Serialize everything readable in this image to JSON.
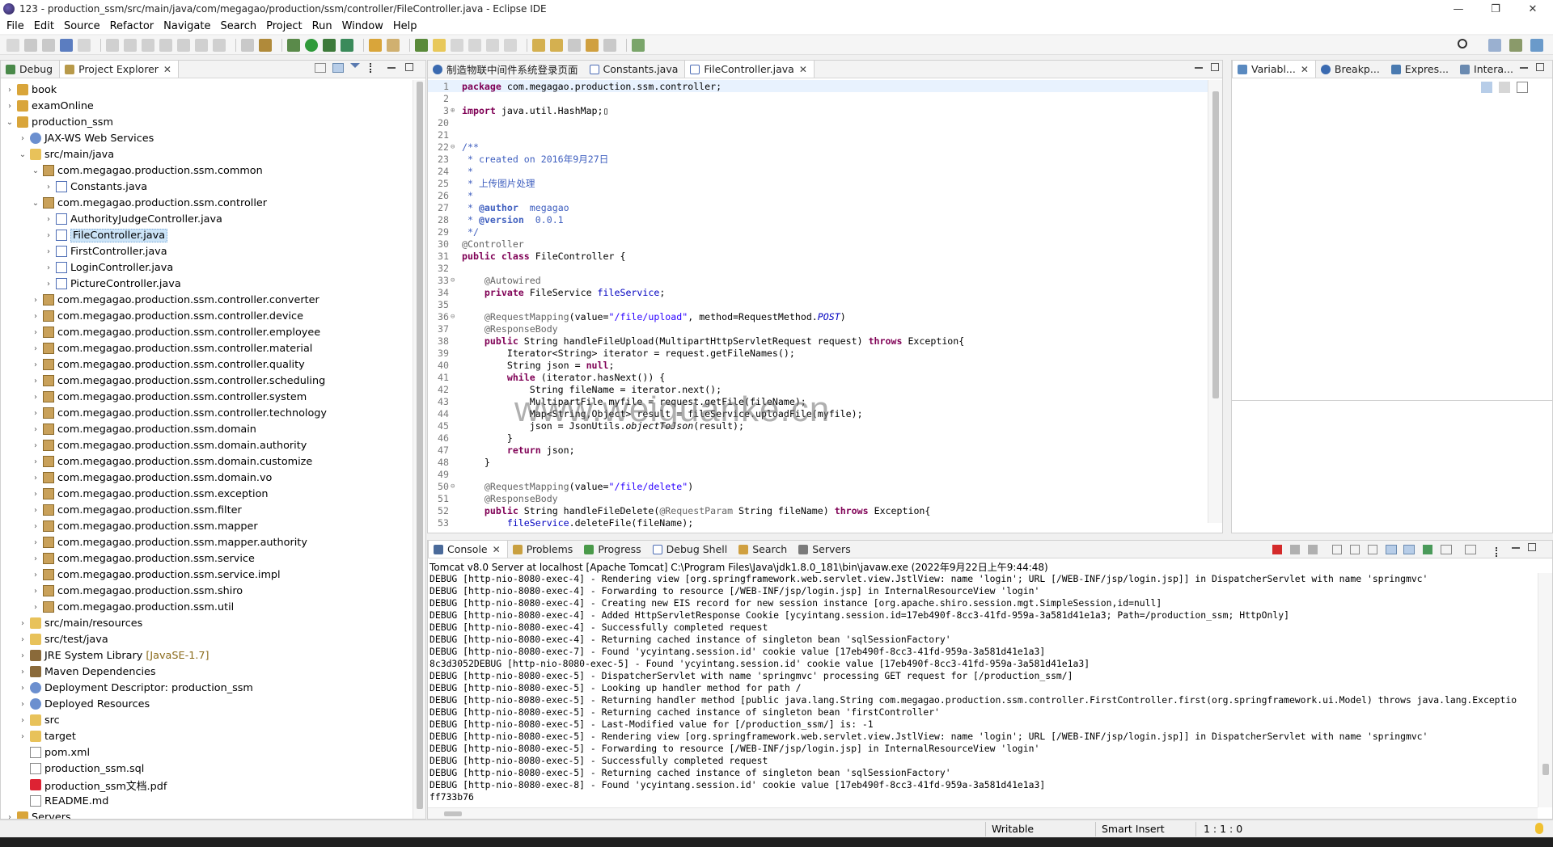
{
  "window": {
    "title": "123 - production_ssm/src/main/java/com/megagao/production/ssm/controller/FileController.java - Eclipse IDE",
    "minimize_glyph": "—",
    "maximize_glyph": "❐",
    "close_glyph": "✕"
  },
  "menu": [
    "File",
    "Edit",
    "Source",
    "Refactor",
    "Navigate",
    "Search",
    "Project",
    "Run",
    "Window",
    "Help"
  ],
  "left_panel": {
    "tabs": [
      {
        "label": "Debug",
        "icon": "debug-icon"
      },
      {
        "label": "Project Explorer",
        "icon": "project-explorer-icon",
        "close": "✕"
      }
    ],
    "tree": [
      {
        "indent": 0,
        "twisty": "›",
        "icon": "project",
        "label": "book"
      },
      {
        "indent": 0,
        "twisty": "›",
        "icon": "project",
        "label": "examOnline"
      },
      {
        "indent": 0,
        "twisty": "⌄",
        "icon": "project",
        "label": "production_ssm"
      },
      {
        "indent": 1,
        "twisty": "›",
        "icon": "ws",
        "label": "JAX-WS Web Services"
      },
      {
        "indent": 1,
        "twisty": "⌄",
        "icon": "folder",
        "label": "src/main/java"
      },
      {
        "indent": 2,
        "twisty": "⌄",
        "icon": "pkg",
        "label": "com.megagao.production.ssm.common"
      },
      {
        "indent": 3,
        "twisty": "›",
        "icon": "java",
        "label": "Constants.java"
      },
      {
        "indent": 2,
        "twisty": "⌄",
        "icon": "pkg",
        "label": "com.megagao.production.ssm.controller"
      },
      {
        "indent": 3,
        "twisty": "›",
        "icon": "java",
        "label": "AuthorityJudgeController.java"
      },
      {
        "indent": 3,
        "twisty": "›",
        "icon": "java",
        "label": "FileController.java",
        "selected": true
      },
      {
        "indent": 3,
        "twisty": "›",
        "icon": "java",
        "label": "FirstController.java"
      },
      {
        "indent": 3,
        "twisty": "›",
        "icon": "java",
        "label": "LoginController.java"
      },
      {
        "indent": 3,
        "twisty": "›",
        "icon": "java",
        "label": "PictureController.java"
      },
      {
        "indent": 2,
        "twisty": "›",
        "icon": "pkg",
        "label": "com.megagao.production.ssm.controller.converter"
      },
      {
        "indent": 2,
        "twisty": "›",
        "icon": "pkg",
        "label": "com.megagao.production.ssm.controller.device"
      },
      {
        "indent": 2,
        "twisty": "›",
        "icon": "pkg",
        "label": "com.megagao.production.ssm.controller.employee"
      },
      {
        "indent": 2,
        "twisty": "›",
        "icon": "pkg",
        "label": "com.megagao.production.ssm.controller.material"
      },
      {
        "indent": 2,
        "twisty": "›",
        "icon": "pkg",
        "label": "com.megagao.production.ssm.controller.quality"
      },
      {
        "indent": 2,
        "twisty": "›",
        "icon": "pkg",
        "label": "com.megagao.production.ssm.controller.scheduling"
      },
      {
        "indent": 2,
        "twisty": "›",
        "icon": "pkg",
        "label": "com.megagao.production.ssm.controller.system"
      },
      {
        "indent": 2,
        "twisty": "›",
        "icon": "pkg",
        "label": "com.megagao.production.ssm.controller.technology"
      },
      {
        "indent": 2,
        "twisty": "›",
        "icon": "pkg",
        "label": "com.megagao.production.ssm.domain"
      },
      {
        "indent": 2,
        "twisty": "›",
        "icon": "pkg",
        "label": "com.megagao.production.ssm.domain.authority"
      },
      {
        "indent": 2,
        "twisty": "›",
        "icon": "pkg",
        "label": "com.megagao.production.ssm.domain.customize"
      },
      {
        "indent": 2,
        "twisty": "›",
        "icon": "pkg",
        "label": "com.megagao.production.ssm.domain.vo"
      },
      {
        "indent": 2,
        "twisty": "›",
        "icon": "pkg",
        "label": "com.megagao.production.ssm.exception"
      },
      {
        "indent": 2,
        "twisty": "›",
        "icon": "pkg",
        "label": "com.megagao.production.ssm.filter"
      },
      {
        "indent": 2,
        "twisty": "›",
        "icon": "pkg",
        "label": "com.megagao.production.ssm.mapper"
      },
      {
        "indent": 2,
        "twisty": "›",
        "icon": "pkg",
        "label": "com.megagao.production.ssm.mapper.authority"
      },
      {
        "indent": 2,
        "twisty": "›",
        "icon": "pkg",
        "label": "com.megagao.production.ssm.service"
      },
      {
        "indent": 2,
        "twisty": "›",
        "icon": "pkg",
        "label": "com.megagao.production.ssm.service.impl"
      },
      {
        "indent": 2,
        "twisty": "›",
        "icon": "pkg",
        "label": "com.megagao.production.ssm.shiro"
      },
      {
        "indent": 2,
        "twisty": "›",
        "icon": "pkg",
        "label": "com.megagao.production.ssm.util"
      },
      {
        "indent": 1,
        "twisty": "›",
        "icon": "folder",
        "label": "src/main/resources"
      },
      {
        "indent": 1,
        "twisty": "›",
        "icon": "folder",
        "label": "src/test/java"
      },
      {
        "indent": 1,
        "twisty": "›",
        "icon": "lib",
        "label": "JRE System Library",
        "suffix": "[JavaSE-1.7]"
      },
      {
        "indent": 1,
        "twisty": "›",
        "icon": "lib",
        "label": "Maven Dependencies"
      },
      {
        "indent": 1,
        "twisty": "›",
        "icon": "ws",
        "label": "Deployment Descriptor: production_ssm"
      },
      {
        "indent": 1,
        "twisty": "›",
        "icon": "ws",
        "label": "Deployed Resources"
      },
      {
        "indent": 1,
        "twisty": "›",
        "icon": "folder",
        "label": "src"
      },
      {
        "indent": 1,
        "twisty": "›",
        "icon": "folder",
        "label": "target"
      },
      {
        "indent": 1,
        "twisty": "",
        "icon": "file",
        "label": "pom.xml"
      },
      {
        "indent": 1,
        "twisty": "",
        "icon": "file",
        "label": "production_ssm.sql"
      },
      {
        "indent": 1,
        "twisty": "",
        "icon": "pdf",
        "label": "production_ssm文档.pdf"
      },
      {
        "indent": 1,
        "twisty": "",
        "icon": "file",
        "label": "README.md"
      },
      {
        "indent": 0,
        "twisty": "›",
        "icon": "project",
        "label": "Servers"
      }
    ]
  },
  "editor": {
    "tabs": [
      {
        "label": "制造物联中间件系统登录页面",
        "active": false
      },
      {
        "label": "Constants.java",
        "active": false
      },
      {
        "label": "FileController.java",
        "active": true,
        "close": "✕"
      }
    ],
    "lines": [
      {
        "n": "1",
        "fold": "",
        "html": "<span class='kw'>package</span> com.megagao.production.ssm.controller;",
        "current": true
      },
      {
        "n": "2",
        "fold": "",
        "html": ""
      },
      {
        "n": "3",
        "fold": "⊕",
        "html": "<span class='kw'>import</span> java.util.HashMap;▯"
      },
      {
        "n": "20",
        "fold": "",
        "html": ""
      },
      {
        "n": "21",
        "fold": "",
        "html": ""
      },
      {
        "n": "22",
        "fold": "⊖",
        "html": "<span class='cm'>/**</span>"
      },
      {
        "n": "23",
        "fold": "",
        "html": "<span class='cm'> * created on 2016年9月27日</span>"
      },
      {
        "n": "24",
        "fold": "",
        "html": "<span class='cm'> *</span>"
      },
      {
        "n": "25",
        "fold": "",
        "html": "<span class='cm'> * 上传图片处理</span>"
      },
      {
        "n": "26",
        "fold": "",
        "html": "<span class='cm'> *</span>"
      },
      {
        "n": "27",
        "fold": "",
        "html": "<span class='cm'> * <b>@author</b>  megagao</span>"
      },
      {
        "n": "28",
        "fold": "",
        "html": "<span class='cm'> * <b>@version</b>  0.0.1</span>"
      },
      {
        "n": "29",
        "fold": "",
        "html": "<span class='cm'> */</span>"
      },
      {
        "n": "30",
        "fold": "",
        "html": "<span class='an'>@Controller</span>"
      },
      {
        "n": "31",
        "fold": "",
        "html": "<span class='kw'>public</span> <span class='kw'>class</span> FileController {"
      },
      {
        "n": "32",
        "fold": "",
        "html": ""
      },
      {
        "n": "33",
        "fold": "⊖",
        "html": "    <span class='an'>@Autowired</span>"
      },
      {
        "n": "34",
        "fold": "",
        "html": "    <span class='kw'>private</span> FileService <span class='fd'>fileService</span>;"
      },
      {
        "n": "35",
        "fold": "",
        "html": ""
      },
      {
        "n": "36",
        "fold": "⊖",
        "html": "    <span class='an'>@RequestMapping</span>(value=<span class='st'>\"/file/upload\"</span>, method=RequestMethod.<span class='fd it'>POST</span>)"
      },
      {
        "n": "37",
        "fold": "",
        "html": "    <span class='an'>@ResponseBody</span>"
      },
      {
        "n": "38",
        "fold": "",
        "html": "    <span class='kw'>public</span> String handleFileUpload(MultipartHttpServletRequest request) <span class='kw'>throws</span> Exception{"
      },
      {
        "n": "39",
        "fold": "",
        "html": "        Iterator&lt;String&gt; iterator = request.getFileNames();"
      },
      {
        "n": "40",
        "fold": "",
        "html": "        String json = <span class='kw'>null</span>;"
      },
      {
        "n": "41",
        "fold": "",
        "html": "        <span class='kw'>while</span> (iterator.hasNext()) {"
      },
      {
        "n": "42",
        "fold": "",
        "html": "            String fileName = iterator.next();"
      },
      {
        "n": "43",
        "fold": "",
        "html": "            MultipartFile myfile = request.getFile(fileName);"
      },
      {
        "n": "44",
        "fold": "",
        "html": "            Map&lt;String,Object&gt; result = fileService.uploadFile(myfile);"
      },
      {
        "n": "45",
        "fold": "",
        "html": "            json = JsonUtils.<span class='it'>objectToJson</span>(result);"
      },
      {
        "n": "46",
        "fold": "",
        "html": "        }"
      },
      {
        "n": "47",
        "fold": "",
        "html": "        <span class='kw'>return</span> json;"
      },
      {
        "n": "48",
        "fold": "",
        "html": "    }"
      },
      {
        "n": "49",
        "fold": "",
        "html": ""
      },
      {
        "n": "50",
        "fold": "⊖",
        "html": "    <span class='an'>@RequestMapping</span>(value=<span class='st'>\"/file/delete\"</span>)"
      },
      {
        "n": "51",
        "fold": "",
        "html": "    <span class='an'>@ResponseBody</span>"
      },
      {
        "n": "52",
        "fold": "",
        "html": "    <span class='kw'>public</span> String handleFileDelete(<span class='an'>@RequestParam</span> String fileName) <span class='kw'>throws</span> Exception{"
      },
      {
        "n": "53",
        "fold": "",
        "html": "        <span class='fd'>fileService</span>.deleteFile(fileName);"
      }
    ]
  },
  "right_panel": {
    "tabs": [
      {
        "label": "Variabl...",
        "close": "✕"
      },
      {
        "label": "Breakp..."
      },
      {
        "label": "Expres..."
      },
      {
        "label": "Intera..."
      }
    ]
  },
  "console": {
    "tabs": [
      {
        "label": "Console",
        "active": true,
        "close": "✕"
      },
      {
        "label": "Problems"
      },
      {
        "label": "Progress"
      },
      {
        "label": "Debug Shell"
      },
      {
        "label": "Search"
      },
      {
        "label": "Servers"
      }
    ],
    "header": "Tomcat v8.0 Server at localhost [Apache Tomcat] C:\\Program Files\\Java\\jdk1.8.0_181\\bin\\javaw.exe  (2022年9月22日上午9:44:48)",
    "lines": [
      "DEBUG [http-nio-8080-exec-4] - Rendering view [org.springframework.web.servlet.view.JstlView: name 'login'; URL [/WEB-INF/jsp/login.jsp]] in DispatcherServlet with name 'springmvc'",
      "DEBUG [http-nio-8080-exec-4] - Forwarding to resource [/WEB-INF/jsp/login.jsp] in InternalResourceView 'login'",
      "DEBUG [http-nio-8080-exec-4] - Creating new EIS record for new session instance [org.apache.shiro.session.mgt.SimpleSession,id=null]",
      "DEBUG [http-nio-8080-exec-4] - Added HttpServletResponse Cookie [ycyintang.session.id=17eb490f-8cc3-41fd-959a-3a581d41e1a3; Path=/production_ssm; HttpOnly]",
      "DEBUG [http-nio-8080-exec-4] - Successfully completed request",
      "DEBUG [http-nio-8080-exec-4] - Returning cached instance of singleton bean 'sqlSessionFactory'",
      "DEBUG [http-nio-8080-exec-7] - Found 'ycyintang.session.id' cookie value [17eb490f-8cc3-41fd-959a-3a581d41e1a3]",
      "8c3d3052DEBUG [http-nio-8080-exec-5] - Found 'ycyintang.session.id' cookie value [17eb490f-8cc3-41fd-959a-3a581d41e1a3]",
      "DEBUG [http-nio-8080-exec-5] - DispatcherServlet with name 'springmvc' processing GET request for [/production_ssm/]",
      "DEBUG [http-nio-8080-exec-5] - Looking up handler method for path /",
      "DEBUG [http-nio-8080-exec-5] - Returning handler method [public java.lang.String com.megagao.production.ssm.controller.FirstController.first(org.springframework.ui.Model) throws java.lang.Exceptio",
      "DEBUG [http-nio-8080-exec-5] - Returning cached instance of singleton bean 'firstController'",
      "DEBUG [http-nio-8080-exec-5] - Last-Modified value for [/production_ssm/] is: -1",
      "DEBUG [http-nio-8080-exec-5] - Rendering view [org.springframework.web.servlet.view.JstlView: name 'login'; URL [/WEB-INF/jsp/login.jsp]] in DispatcherServlet with name 'springmvc'",
      "DEBUG [http-nio-8080-exec-5] - Forwarding to resource [/WEB-INF/jsp/login.jsp] in InternalResourceView 'login'",
      "DEBUG [http-nio-8080-exec-5] - Successfully completed request",
      "DEBUG [http-nio-8080-exec-5] - Returning cached instance of singleton bean 'sqlSessionFactory'",
      "DEBUG [http-nio-8080-exec-8] - Found 'ycyintang.session.id' cookie value [17eb490f-8cc3-41fd-959a-3a581d41e1a3]",
      "ff733b76"
    ]
  },
  "status": {
    "mode": "Writable",
    "insert": "Smart Insert",
    "position": "1 : 1 : 0"
  },
  "watermark": "www.weiguanke.cn",
  "colors": {
    "keyword": "#7f0055",
    "comment": "#3f5fbf",
    "string": "#2a00ff",
    "annotation": "#646464"
  }
}
